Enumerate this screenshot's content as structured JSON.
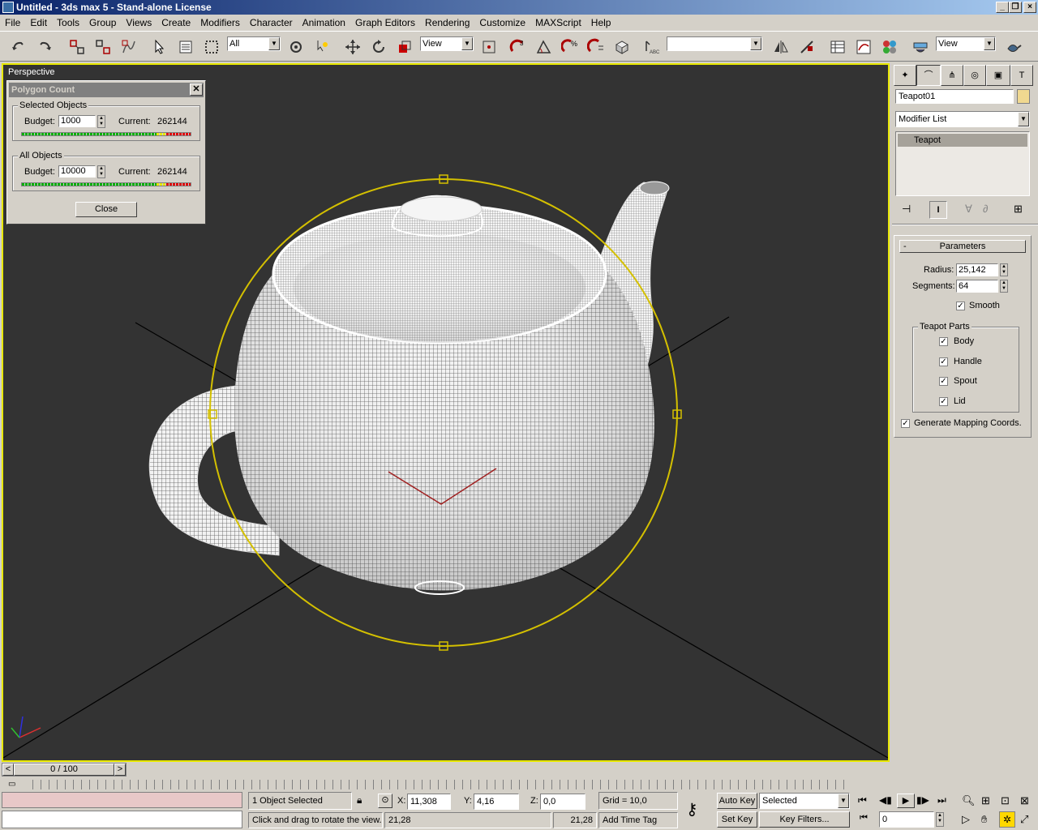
{
  "window": {
    "title": "Untitled - 3ds max 5 - Stand-alone License"
  },
  "menu": [
    "File",
    "Edit",
    "Tools",
    "Group",
    "Views",
    "Create",
    "Modifiers",
    "Character",
    "Animation",
    "Graph Editors",
    "Rendering",
    "Customize",
    "MAXScript",
    "Help"
  ],
  "toolbar": {
    "selection_filter": "All",
    "ref_coord": "View",
    "named_selection": "",
    "render_view": "View"
  },
  "viewport": {
    "label": "Perspective"
  },
  "polygon_dialog": {
    "title": "Polygon Count",
    "selected_group": "Selected Objects",
    "all_group": "All Objects",
    "budget_label": "Budget:",
    "current_label": "Current:",
    "selected_budget": "1000",
    "selected_current": "262144",
    "all_budget": "10000",
    "all_current": "262144",
    "close_label": "Close",
    "close_x": "✕"
  },
  "command_panel": {
    "object_name": "Teapot01",
    "object_color": "#f0d890",
    "modifier_list": "Modifier List",
    "stack_item": "Teapot",
    "rollout_toggle": "-",
    "rollout_title": "Parameters",
    "radius_label": "Radius:",
    "radius_value": "25,142",
    "segments_label": "Segments:",
    "segments_value": "64",
    "smooth_label": "Smooth",
    "smooth_checked": true,
    "parts_group": "Teapot Parts",
    "parts": [
      {
        "label": "Body",
        "checked": true
      },
      {
        "label": "Handle",
        "checked": true
      },
      {
        "label": "Spout",
        "checked": true
      },
      {
        "label": "Lid",
        "checked": true
      }
    ],
    "mapping_label": "Generate Mapping Coords.",
    "mapping_checked": true
  },
  "timeline": {
    "frame": "0 / 100",
    "prev": "<",
    "next": ">"
  },
  "status": {
    "selection": "1 Object Selected",
    "prompt": "Click and drag to rotate the view.",
    "coord1": "21,28",
    "coord2": "21,28",
    "x_label": "X:",
    "x_value": "11,308",
    "y_label": "Y:",
    "y_value": "4,16",
    "z_label": "Z:",
    "z_value": "0,0",
    "grid": "Grid = 10,0",
    "add_time_tag": "Add Time Tag",
    "auto_key": "Auto Key",
    "set_key": "Set Key",
    "key_mode": "Selected",
    "key_filters": "Key Filters...",
    "current_frame": "0"
  },
  "colors": {
    "viewport_bg": "#333333",
    "viewport_border": "#e8e800",
    "selection_gizmo": "#d4c000"
  }
}
